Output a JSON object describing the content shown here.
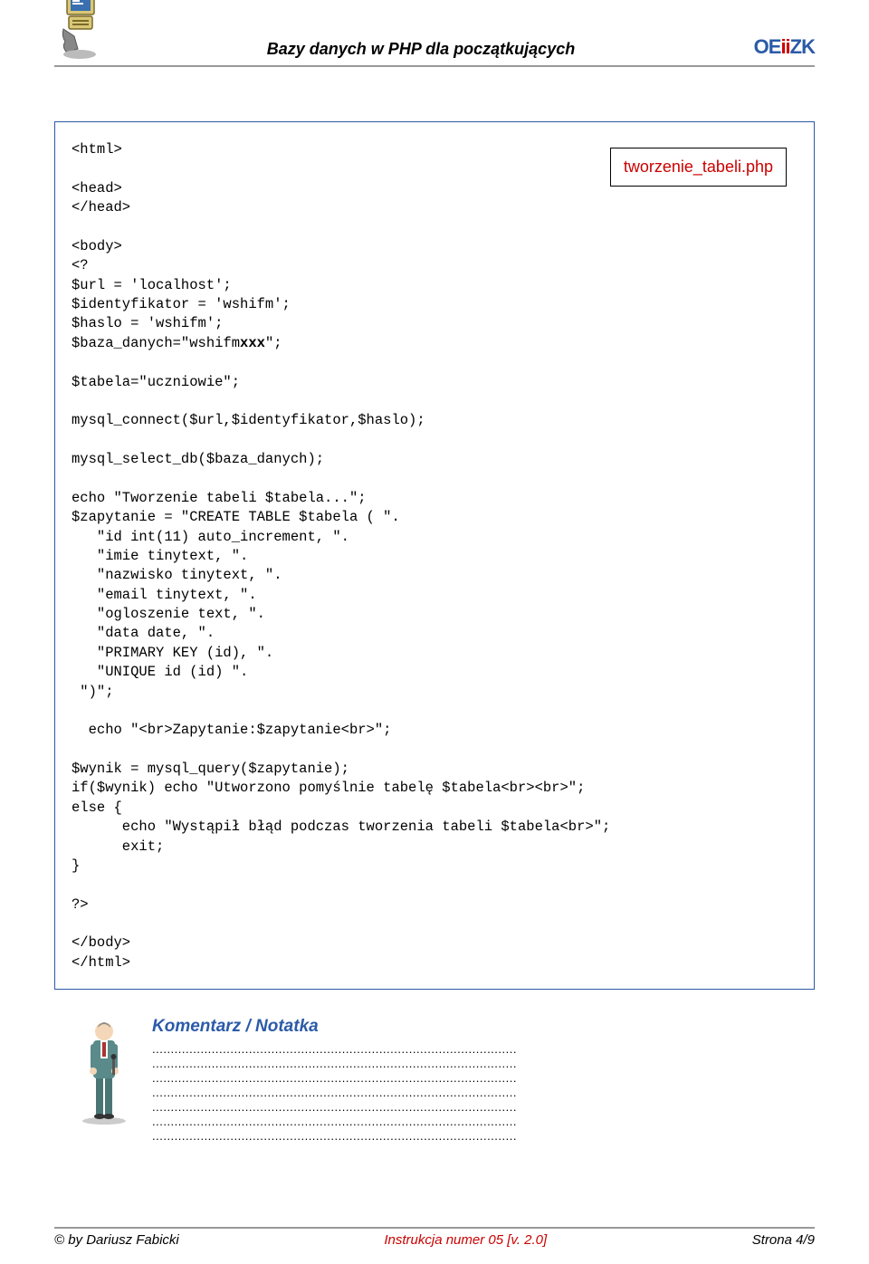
{
  "header": {
    "title": "Bazy danych w PHP dla początkujących",
    "logo_parts": {
      "p1": "OE",
      "p2": "ii",
      "p3": "ZK"
    }
  },
  "file_label": "tworzenie_tabeli.php",
  "code": {
    "l01": "<html>",
    "l02": "<head>",
    "l03": "</head>",
    "l04": "<body>",
    "l05": "<?",
    "l06": "$url = 'localhost';",
    "l07": "$identyfikator = 'wshifm';",
    "l08": "$haslo = 'wshifm';",
    "l09a": "$baza_danych=\"wshifm",
    "l09b": "xxx",
    "l09c": "\";",
    "l10": "$tabela=\"uczniowie\";",
    "l11": "mysql_connect($url,$identyfikator,$haslo);",
    "l12": "mysql_select_db($baza_danych);",
    "l13": "echo \"Tworzenie tabeli $tabela...\";",
    "l14": "$zapytanie = \"CREATE TABLE $tabela ( \".",
    "l15": "   \"id int(11) auto_increment, \".",
    "l16": "   \"imie tinytext, \".",
    "l17": "   \"nazwisko tinytext, \".",
    "l18": "   \"email tinytext, \".",
    "l19": "   \"ogloszenie text, \".",
    "l20": "   \"data date, \".",
    "l21": "   \"PRIMARY KEY (id), \".",
    "l22": "   \"UNIQUE id (id) \".",
    "l23": " \")\";",
    "l24": "  echo \"<br>Zapytanie:$zapytanie<br>\";",
    "l25": "$wynik = mysql_query($zapytanie);",
    "l26": "if($wynik) echo \"Utworzono pomyślnie tabelę $tabela<br><br>\";",
    "l27": "else {",
    "l28": "      echo \"Wystąpił błąd podczas tworzenia tabeli $tabela<br>\";",
    "l29": "      exit;",
    "l30": "}",
    "l31": "?>",
    "l32": "</body>",
    "l33": "</html>"
  },
  "notes": {
    "title": "Komentarz / Notatka",
    "line": "..................................................................................................",
    "count": 7
  },
  "footer": {
    "left": "© by Dariusz Fabicki",
    "center": "Instrukcja numer 05   [v. 2.0]",
    "right": "Strona 4/9"
  }
}
